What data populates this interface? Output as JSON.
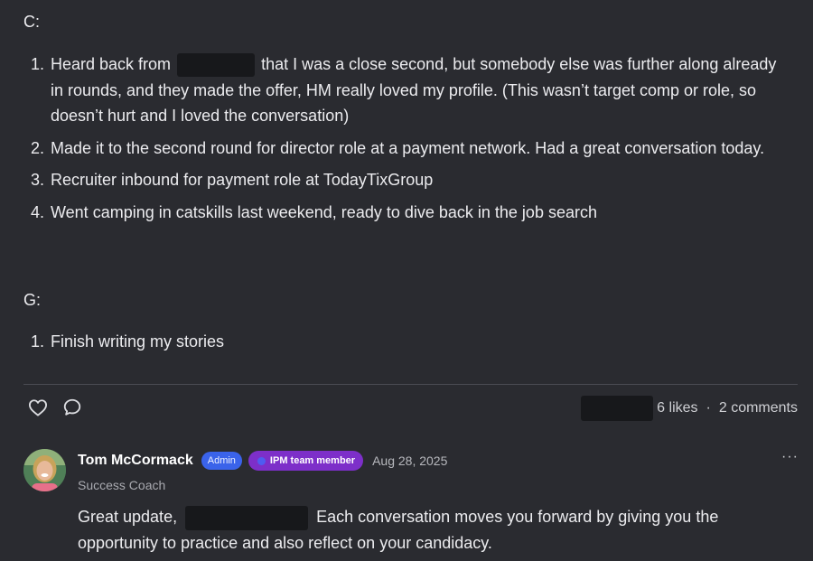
{
  "post": {
    "sections": [
      {
        "label": "C:",
        "items": [
          {
            "num": "1.",
            "before": "Heard back from",
            "after": "that I was a close second, but somebody else was further along already in rounds, and they made the offer, HM really loved my profile. (This wasn’t target comp or role, so doesn’t hurt and I loved the conversation)"
          },
          {
            "num": "2.",
            "text": "Made it to the second round for director role at a payment network. Had a great conversation today."
          },
          {
            "num": "3.",
            "text": "Recruiter inbound for payment role at TodayTixGroup"
          },
          {
            "num": "4.",
            "text": "Went camping in catskills last weekend, ready to dive back in the job search"
          }
        ]
      },
      {
        "label": "G:",
        "items": [
          {
            "num": "1.",
            "text": "Finish writing my stories"
          }
        ]
      }
    ]
  },
  "engagement": {
    "like_icon": "heart-icon",
    "comment_icon": "comment-bubble-icon",
    "likes": "6 likes",
    "separator": "·",
    "comments": "2 comments"
  },
  "comment": {
    "author": "Tom McCormack",
    "admin_badge": "Admin",
    "team_badge": "IPM team member",
    "date": "Aug 28, 2025",
    "role": "Success Coach",
    "more": "···",
    "text_before": "Great update,",
    "text_after": "Each conversation moves you forward by giving you the opportunity to practice and also reflect on your candidacy."
  },
  "colors": {
    "background": "#2a2b30",
    "admin_badge": "#3a63ea",
    "team_badge": "#7d2fc9",
    "redaction": "#17181b"
  }
}
